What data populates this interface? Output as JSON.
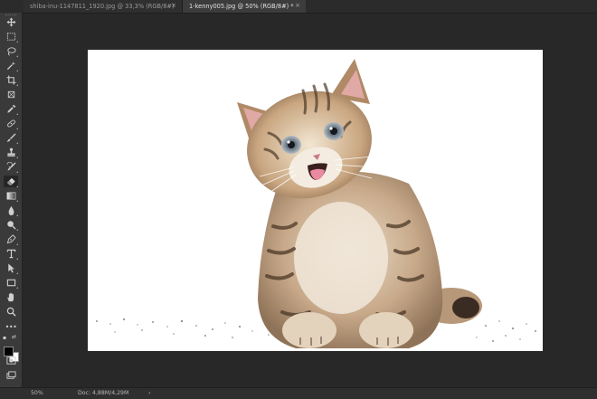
{
  "tabs": [
    {
      "title": "shiba-inu-1147811_1920.jpg @ 33,3% (RGB/8#)",
      "close": "×"
    },
    {
      "title": "1-kenny005.jpg @ 50% (RGB/8#) *",
      "close": "×"
    }
  ],
  "status": {
    "zoom": "50%",
    "doc": "Doc: 4,88M/4,29M",
    "arrow": "›"
  },
  "tools": [
    {
      "name": "move-tool-icon"
    },
    {
      "name": "marquee-tool-icon"
    },
    {
      "name": "lasso-tool-icon"
    },
    {
      "name": "magic-wand-tool-icon"
    },
    {
      "name": "crop-tool-icon"
    },
    {
      "name": "frame-tool-icon"
    },
    {
      "name": "eyedropper-tool-icon"
    },
    {
      "name": "healing-brush-tool-icon"
    },
    {
      "name": "brush-tool-icon"
    },
    {
      "name": "clone-stamp-tool-icon"
    },
    {
      "name": "history-brush-tool-icon"
    },
    {
      "name": "eraser-tool-icon"
    },
    {
      "name": "gradient-tool-icon"
    },
    {
      "name": "blur-tool-icon"
    },
    {
      "name": "dodge-tool-icon"
    },
    {
      "name": "pen-tool-icon"
    },
    {
      "name": "type-tool-icon"
    },
    {
      "name": "path-selection-tool-icon"
    },
    {
      "name": "rectangle-tool-icon"
    },
    {
      "name": "hand-tool-icon"
    },
    {
      "name": "zoom-tool-icon"
    },
    {
      "name": "more-tools-icon"
    }
  ],
  "colors": {
    "foreground": "#000000",
    "background": "#ffffff",
    "panel": "#3a3a3a",
    "workspace": "#282828"
  }
}
